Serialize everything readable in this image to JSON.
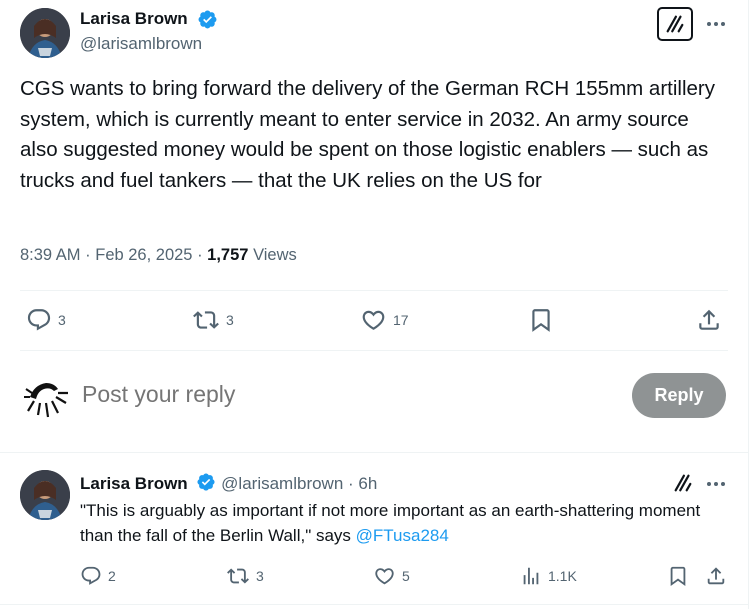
{
  "main_tweet": {
    "author_name": "Larisa Brown",
    "author_handle": "@larisamlbrown",
    "text": "CGS wants to bring forward the delivery of the German RCH 155mm artillery system, which is currently meant to enter service in 2032. An army source also suggested money would be spent on those logistic enablers — such as trucks and fuel tankers — that the UK relies on the US for",
    "time": "8:39 AM",
    "date": "Feb 26, 2025",
    "views_count": "1,757",
    "views_label": "Views",
    "replies": "3",
    "reposts": "3",
    "likes": "17"
  },
  "composer": {
    "placeholder": "Post your reply",
    "button_label": "Reply"
  },
  "reply_tweet": {
    "author_name": "Larisa Brown",
    "author_handle": "@larisamlbrown",
    "age": "6h",
    "text": "\"This is arguably as important if not more important as an earth-shattering moment than the fall of the Berlin Wall,\" says ",
    "mention": "@FTusa284",
    "replies": "2",
    "reposts": "3",
    "likes": "5",
    "views": "1.1K"
  },
  "colors": {
    "accent": "#1d9bf0",
    "muted": "#536471",
    "text": "#0f1419",
    "reply_button_disabled": "#8f9394"
  }
}
